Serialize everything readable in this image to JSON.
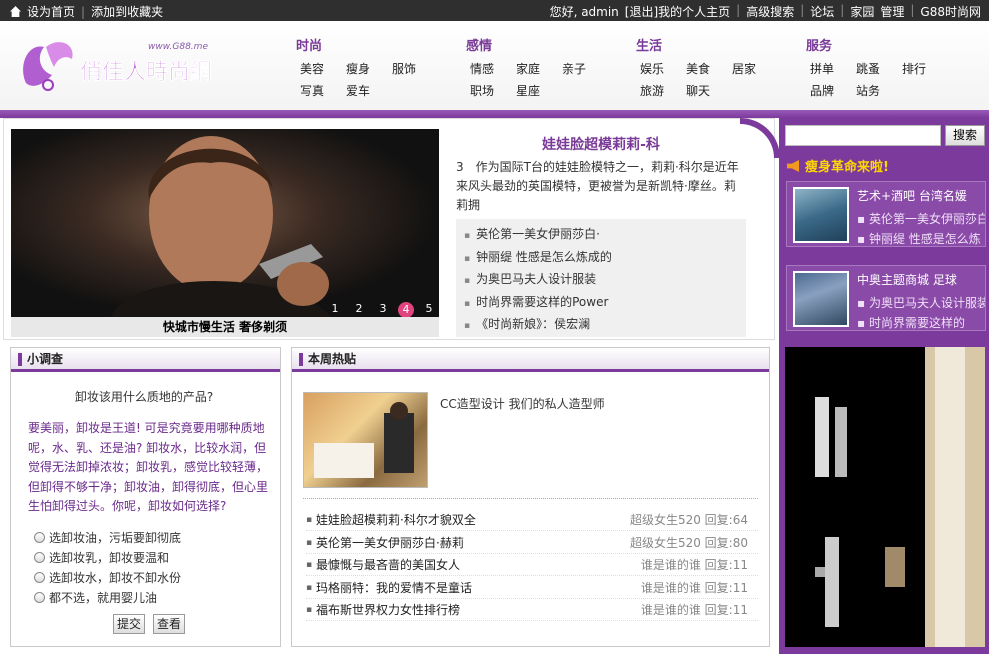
{
  "topbar": {
    "home": "设为首页",
    "sep": "|",
    "fav": "添加到收藏夹",
    "right": [
      "您好, admin",
      "[退出]我的个人主页",
      "|",
      "高级搜索",
      "|",
      "论坛",
      "|",
      "家园",
      "管理",
      "|",
      "G88时尚网"
    ]
  },
  "logo": {
    "text": "俏佳人時尚網",
    "url_text": "www.G88.me"
  },
  "nav": [
    {
      "title": "时尚",
      "rows": [
        [
          "美容",
          "瘦身",
          "服饰"
        ],
        [
          "写真",
          "爱车"
        ]
      ]
    },
    {
      "title": "感情",
      "rows": [
        [
          "情感",
          "家庭",
          "亲子"
        ],
        [
          "职场",
          "星座"
        ]
      ]
    },
    {
      "title": "生活",
      "rows": [
        [
          "娱乐",
          "美食",
          "居家"
        ],
        [
          "旅游",
          "聊天"
        ]
      ]
    },
    {
      "title": "服务",
      "rows": [
        [
          "拼单",
          "跳蚤",
          "排行"
        ],
        [
          "品牌",
          "站务"
        ]
      ]
    }
  ],
  "hero": {
    "caption": "快城市慢生活 奢侈剃须",
    "pages": [
      "1",
      "2",
      "3",
      "4",
      "5"
    ],
    "active_page": 4
  },
  "headline": "娃娃脸超模莉莉-科",
  "summary": "3　作为国际T台的娃娃脸模特之一，莉莉·科尔是近年来风头最劲的英国模特，更被誉为是新凯特·摩丝。莉莉拥",
  "news": [
    "英伦第一美女伊丽莎白·",
    "钟丽缇 性感是怎么炼成的",
    "为奥巴马夫人设计服装",
    "时尚界需要这样的Power",
    "《时尚新娘》：侯宏澜"
  ],
  "search": {
    "button": "搜索",
    "placeholder": ""
  },
  "right": {
    "heading": "瘦身革命来啦!",
    "cards": [
      {
        "title": "艺术+酒吧 台湾名媛",
        "links": [
          "英伦第一美女伊丽莎白",
          "钟丽缇 性感是怎么炼"
        ]
      },
      {
        "title": "中奥主题商城 足球",
        "links": [
          "为奥巴马夫人设计服装",
          "时尚界需要这样的"
        ]
      }
    ]
  },
  "poll": {
    "title": "小调查",
    "question": "卸妆该用什么质地的产品?",
    "desc": "要美丽，卸妆是王道! 可是究竟要用哪种质地呢，水、乳、还是油? 卸妆水，比较水润，但觉得无法卸掉浓妆；卸妆乳，感觉比较轻薄，但卸得不够干净；卸妆油，卸得彻底，但心里生怕卸得过头。你呢，卸妆如何选择?",
    "options": [
      "选卸妆油，污垢要卸彻底",
      "选卸妆乳，卸妆要温和",
      "选卸妆水，卸妆不卸水份",
      "都不选，就用婴儿油"
    ],
    "submit": "提交",
    "view": "查看"
  },
  "hot": {
    "title": "本周热贴",
    "feature_caption": "CC造型设计 我们的私人造型师",
    "rows": [
      {
        "title": "娃娃脸超模莉莉·科尔才貌双全",
        "author": "超级女生520",
        "replies": "回复:64"
      },
      {
        "title": "英伦第一美女伊丽莎白·赫莉",
        "author": "超级女生520",
        "replies": "回复:80"
      },
      {
        "title": "最慷慨与最吝啬的美国女人",
        "author": "谁是谁的谁",
        "replies": "回复:11"
      },
      {
        "title": "玛格丽特：我的爱情不是童话",
        "author": "谁是谁的谁",
        "replies": "回复:11"
      },
      {
        "title": "福布斯世界权力女性排行榜",
        "author": "谁是谁的谁",
        "replies": "回复:11"
      }
    ]
  },
  "colors": {
    "purple": "#7b3a9c",
    "pink": "#e0437e",
    "dark": "#2f2f2f"
  }
}
